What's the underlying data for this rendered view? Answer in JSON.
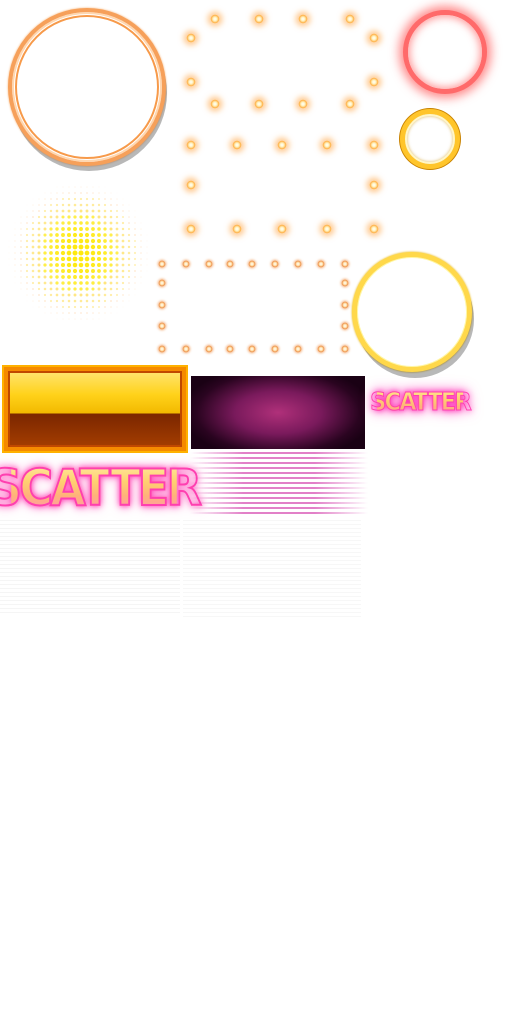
{
  "sprite_sheet": {
    "scatter_large_text": "SCATTER",
    "scatter_small_text": "SCATTER",
    "colors": {
      "orange_ring": "#f6a05a",
      "red_glow_ring": "#ff6a6a",
      "gold_ring": "#ffc52b",
      "yellow_ring": "#ffd84a",
      "bulb_glow": "#ffb24a",
      "halftone_yellow": "#ffe600",
      "gold_bar_top": "#ffd21a",
      "gold_bar_bottom": "#a23c00",
      "magenta_panel": "#b0307a",
      "pink_stripes": "#d23caa",
      "scatter_outline": "#ff3fb0"
    }
  }
}
